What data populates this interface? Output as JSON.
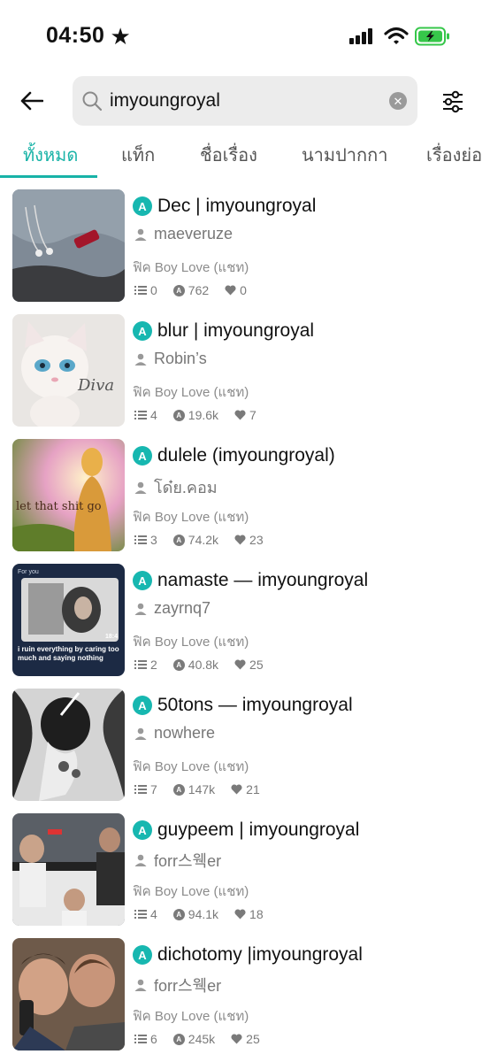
{
  "status_bar": {
    "time": "04:50",
    "colors": {
      "battery": "#36c74a"
    }
  },
  "search": {
    "query": "imyoungroyal"
  },
  "tabs": [
    {
      "label": "ทั้งหมด",
      "active": true
    },
    {
      "label": "แท็ก",
      "active": false
    },
    {
      "label": "ชื่อเรื่อง",
      "active": false
    },
    {
      "label": "นามปากกา",
      "active": false
    },
    {
      "label": "เรื่องย่อ",
      "active": false
    }
  ],
  "results": [
    {
      "badge": "A",
      "title": "Dec | imyoungroyal",
      "author": "maeveruze",
      "genre": "ฟิค Boy Love (แชท)",
      "chapters": "0",
      "views": "762",
      "likes": "0"
    },
    {
      "badge": "A",
      "title": "blur | imyoungroyal",
      "author": "Robin’s",
      "genre": "ฟิค Boy Love (แชท)",
      "chapters": "4",
      "views": "19.6k",
      "likes": "7",
      "thumb_text": "Diva"
    },
    {
      "badge": "A",
      "title": "dulele (imyoungroyal)",
      "author": "โด๋ย.คอม",
      "genre": "ฟิค Boy Love (แชท)",
      "chapters": "3",
      "views": "74.2k",
      "likes": "23",
      "thumb_text": "let that shit go"
    },
    {
      "badge": "A",
      "title": "namaste — imyoungroyal",
      "author": "zayrnq7",
      "genre": "ฟิค Boy Love (แชท)",
      "chapters": "2",
      "views": "40.8k",
      "likes": "25",
      "thumb_text": "i ruin everything by caring too much and saying nothing",
      "thumb_header": "For you",
      "thumb_time": "18:4"
    },
    {
      "badge": "A",
      "title": "50tons — imyoungroyal",
      "author": "nowhere",
      "genre": "ฟิค Boy Love (แชท)",
      "chapters": "7",
      "views": "147k",
      "likes": "21"
    },
    {
      "badge": "A",
      "title": "guypeem | imyoungroyal",
      "author": "forr스웩er",
      "genre": "ฟิค Boy Love (แชท)",
      "chapters": "4",
      "views": "94.1k",
      "likes": "18"
    },
    {
      "badge": "A",
      "title": "dichotomy |imyoungroyal",
      "author": "forr스웩er",
      "genre": "ฟิค Boy Love (แชท)",
      "chapters": "6",
      "views": "245k",
      "likes": "25"
    }
  ]
}
